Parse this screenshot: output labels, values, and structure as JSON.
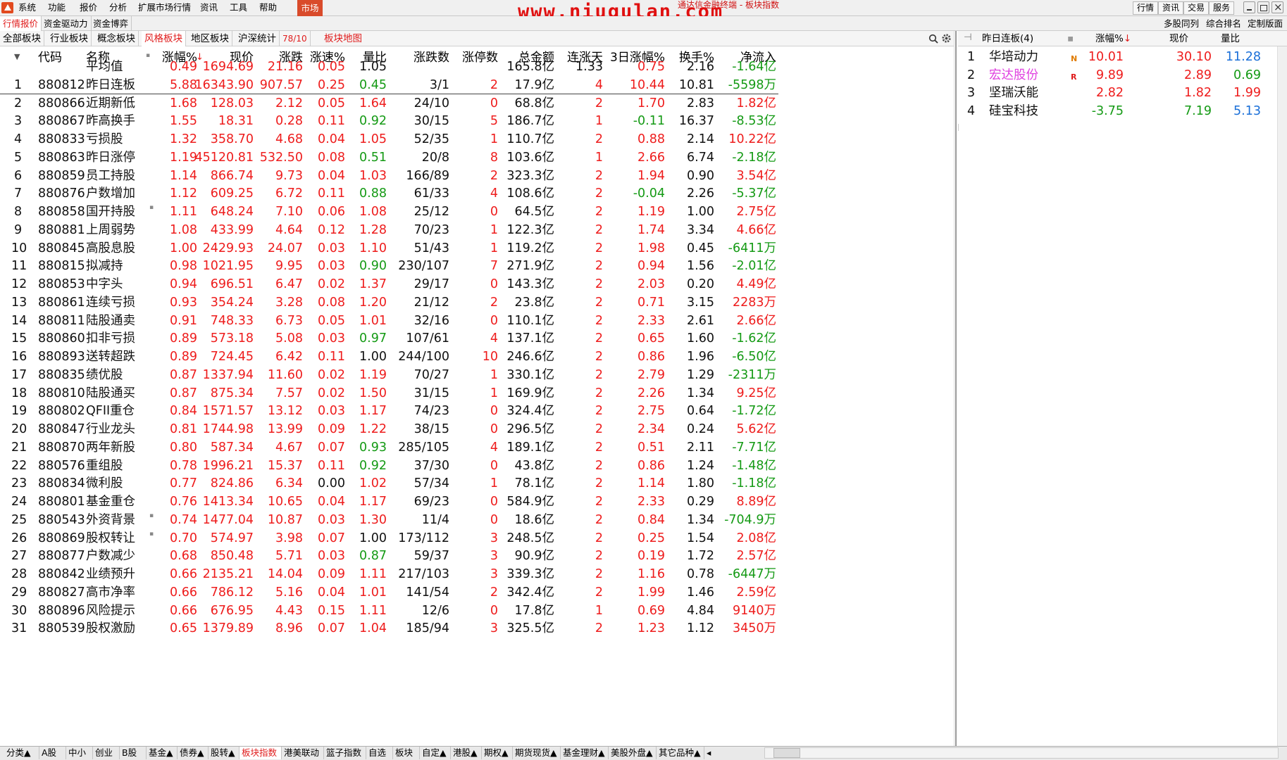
{
  "menubar": {
    "items": [
      "系统",
      "功能",
      "报价",
      "分析",
      "扩展市场行情",
      "资讯",
      "工具",
      "帮助"
    ],
    "market": "市场",
    "marquee": "通达信金融终端 - 板块指数",
    "watermark": "www.niugulan.com",
    "right_buttons": [
      "行情",
      "资讯",
      "交易",
      "服务"
    ]
  },
  "tabs_row2": {
    "items": [
      "行情报价",
      "资金驱动力",
      "资金博弈"
    ],
    "right": [
      "多股同列",
      "综合排名",
      "定制版面"
    ]
  },
  "tabs_row3": {
    "items": [
      "全部板块",
      "行业板块",
      "概念板块",
      "风格板块",
      "地区板块",
      "沪深统计"
    ],
    "count": "78/10",
    "extra": "板块地图"
  },
  "table": {
    "headers": [
      "代码",
      "名称",
      "涨幅%",
      "现价",
      "涨跌",
      "涨速%",
      "量比",
      "涨跌数",
      "涨停数",
      "总金额",
      "连涨天",
      "3日涨幅%",
      "换手%",
      "净流入"
    ],
    "average": {
      "label": "平均值",
      "vals": [
        "0.49",
        "1694.69",
        "21.16",
        "0.05",
        "1.05",
        "",
        "",
        "165.8亿",
        "1.33",
        "0.75",
        "2.16",
        "-1.64亿"
      ]
    },
    "rows": [
      [
        "1",
        "880812",
        "昨日连板",
        "5.88",
        "16343.90",
        "907.57",
        "0.25",
        "0.45",
        "3/1",
        "2",
        "17.9亿",
        "4",
        "10.44",
        "10.81",
        "-5598万"
      ],
      [
        "2",
        "880866",
        "近期新低",
        "1.68",
        "128.03",
        "2.12",
        "0.05",
        "1.64",
        "24/10",
        "0",
        "68.8亿",
        "2",
        "1.70",
        "2.83",
        "1.82亿"
      ],
      [
        "3",
        "880867",
        "昨高换手",
        "1.55",
        "18.31",
        "0.28",
        "0.11",
        "0.92",
        "30/15",
        "5",
        "186.7亿",
        "1",
        "-0.11",
        "16.37",
        "-8.53亿"
      ],
      [
        "4",
        "880833",
        "亏损股",
        "1.32",
        "358.70",
        "4.68",
        "0.04",
        "1.05",
        "52/35",
        "1",
        "110.7亿",
        "2",
        "0.88",
        "2.14",
        "10.22亿"
      ],
      [
        "5",
        "880863",
        "昨日涨停",
        "1.19",
        "45120.81",
        "532.50",
        "0.08",
        "0.51",
        "20/8",
        "8",
        "103.6亿",
        "1",
        "2.66",
        "6.74",
        "-2.18亿"
      ],
      [
        "6",
        "880859",
        "员工持股",
        "1.14",
        "866.74",
        "9.73",
        "0.04",
        "1.03",
        "166/89",
        "2",
        "323.3亿",
        "2",
        "1.94",
        "0.90",
        "3.54亿"
      ],
      [
        "7",
        "880876",
        "户数增加",
        "1.12",
        "609.25",
        "6.72",
        "0.11",
        "0.88",
        "61/33",
        "4",
        "108.6亿",
        "2",
        "-0.04",
        "2.26",
        "-5.37亿"
      ],
      [
        "8",
        "880858",
        "国开持股",
        "1.11",
        "648.24",
        "7.10",
        "0.06",
        "1.08",
        "25/12",
        "0",
        "64.5亿",
        "2",
        "1.19",
        "1.00",
        "2.75亿"
      ],
      [
        "9",
        "880881",
        "上周弱势",
        "1.08",
        "433.99",
        "4.64",
        "0.12",
        "1.28",
        "70/23",
        "1",
        "122.3亿",
        "2",
        "1.74",
        "3.34",
        "4.66亿"
      ],
      [
        "10",
        "880845",
        "高股息股",
        "1.00",
        "2429.93",
        "24.07",
        "0.03",
        "1.10",
        "51/43",
        "1",
        "119.2亿",
        "2",
        "1.98",
        "0.45",
        "-6411万"
      ],
      [
        "11",
        "880815",
        "拟减持",
        "0.98",
        "1021.95",
        "9.95",
        "0.03",
        "0.90",
        "230/107",
        "7",
        "271.9亿",
        "2",
        "0.94",
        "1.56",
        "-2.01亿"
      ],
      [
        "12",
        "880853",
        "中字头",
        "0.94",
        "696.51",
        "6.47",
        "0.02",
        "1.37",
        "29/17",
        "0",
        "143.3亿",
        "2",
        "2.03",
        "0.20",
        "4.49亿"
      ],
      [
        "13",
        "880861",
        "连续亏损",
        "0.93",
        "354.24",
        "3.28",
        "0.08",
        "1.20",
        "21/12",
        "2",
        "23.8亿",
        "2",
        "0.71",
        "3.15",
        "2283万"
      ],
      [
        "14",
        "880811",
        "陆股通卖",
        "0.91",
        "748.33",
        "6.73",
        "0.05",
        "1.01",
        "32/16",
        "0",
        "110.1亿",
        "2",
        "2.33",
        "2.61",
        "2.66亿"
      ],
      [
        "15",
        "880860",
        "扣非亏损",
        "0.89",
        "573.18",
        "5.08",
        "0.03",
        "0.97",
        "107/61",
        "4",
        "137.1亿",
        "2",
        "0.65",
        "1.60",
        "-1.62亿"
      ],
      [
        "16",
        "880893",
        "送转超跌",
        "0.89",
        "724.45",
        "6.42",
        "0.11",
        "1.00",
        "244/100",
        "10",
        "246.6亿",
        "2",
        "0.86",
        "1.96",
        "-6.50亿"
      ],
      [
        "17",
        "880835",
        "绩优股",
        "0.87",
        "1337.94",
        "11.60",
        "0.02",
        "1.19",
        "70/27",
        "1",
        "330.1亿",
        "2",
        "2.79",
        "1.29",
        "-2311万"
      ],
      [
        "18",
        "880810",
        "陆股通买",
        "0.87",
        "875.34",
        "7.57",
        "0.02",
        "1.50",
        "31/15",
        "1",
        "169.9亿",
        "2",
        "2.26",
        "1.34",
        "9.25亿"
      ],
      [
        "19",
        "880802",
        "QFII重仓",
        "0.84",
        "1571.57",
        "13.12",
        "0.03",
        "1.17",
        "74/23",
        "0",
        "324.4亿",
        "2",
        "2.75",
        "0.64",
        "-1.72亿"
      ],
      [
        "20",
        "880847",
        "行业龙头",
        "0.81",
        "1744.98",
        "13.99",
        "0.09",
        "1.22",
        "38/15",
        "0",
        "296.5亿",
        "2",
        "2.34",
        "0.24",
        "5.62亿"
      ],
      [
        "21",
        "880870",
        "两年新股",
        "0.80",
        "587.34",
        "4.67",
        "0.07",
        "0.93",
        "285/105",
        "4",
        "189.1亿",
        "2",
        "0.51",
        "2.11",
        "-7.71亿"
      ],
      [
        "22",
        "880576",
        "重组股",
        "0.78",
        "1996.21",
        "15.37",
        "0.11",
        "0.92",
        "37/30",
        "0",
        "43.8亿",
        "2",
        "0.86",
        "1.24",
        "-1.48亿"
      ],
      [
        "23",
        "880834",
        "微利股",
        "0.77",
        "824.86",
        "6.34",
        "0.00",
        "1.02",
        "57/34",
        "1",
        "78.1亿",
        "2",
        "1.14",
        "1.80",
        "-1.18亿"
      ],
      [
        "24",
        "880801",
        "基金重仓",
        "0.76",
        "1413.34",
        "10.65",
        "0.04",
        "1.17",
        "69/23",
        "0",
        "584.9亿",
        "2",
        "2.33",
        "0.29",
        "8.89亿"
      ],
      [
        "25",
        "880543",
        "外资背景",
        "0.74",
        "1477.04",
        "10.87",
        "0.03",
        "1.30",
        "11/4",
        "0",
        "18.6亿",
        "2",
        "0.84",
        "1.34",
        "-704.9万"
      ],
      [
        "26",
        "880869",
        "股权转让",
        "0.70",
        "574.97",
        "3.98",
        "0.07",
        "1.00",
        "173/112",
        "3",
        "248.5亿",
        "2",
        "0.25",
        "1.54",
        "2.08亿"
      ],
      [
        "27",
        "880877",
        "户数减少",
        "0.68",
        "850.48",
        "5.71",
        "0.03",
        "0.87",
        "59/37",
        "3",
        "90.9亿",
        "2",
        "0.19",
        "1.72",
        "2.57亿"
      ],
      [
        "28",
        "880842",
        "业绩预升",
        "0.66",
        "2135.21",
        "14.04",
        "0.09",
        "1.11",
        "217/103",
        "3",
        "339.3亿",
        "2",
        "1.16",
        "0.78",
        "-6447万"
      ],
      [
        "29",
        "880827",
        "高市净率",
        "0.66",
        "786.12",
        "5.16",
        "0.04",
        "1.01",
        "141/54",
        "2",
        "342.4亿",
        "2",
        "1.99",
        "1.46",
        "2.59亿"
      ],
      [
        "30",
        "880896",
        "风险提示",
        "0.66",
        "676.95",
        "4.43",
        "0.15",
        "1.11",
        "12/6",
        "0",
        "17.8亿",
        "1",
        "0.69",
        "4.84",
        "9140万"
      ],
      [
        "31",
        "880539",
        "股权激励",
        "0.65",
        "1379.89",
        "8.96",
        "0.07",
        "1.04",
        "185/94",
        "3",
        "325.5亿",
        "2",
        "1.23",
        "1.12",
        "3450万"
      ]
    ]
  },
  "right_panel": {
    "title": "昨日连板(4)",
    "headers": [
      "涨幅%",
      "现价",
      "量比"
    ],
    "rows": [
      [
        "1",
        "华培动力",
        "N",
        "10.01",
        "30.10",
        "11.28"
      ],
      [
        "2",
        "宏达股份",
        "R",
        "9.89",
        "2.89",
        "0.69"
      ],
      [
        "3",
        "坚瑞沃能",
        "",
        "2.82",
        "1.82",
        "1.99"
      ],
      [
        "4",
        "硅宝科技",
        "",
        "-3.75",
        "7.19",
        "5.13"
      ]
    ]
  },
  "bottom_tabs": [
    "分类▲",
    "A股",
    "中小",
    "创业",
    "B股",
    "基金▲",
    "债券▲",
    "股转▲",
    "板块指数",
    "港美联动",
    "篮子指数",
    "自选",
    "板块",
    "自定▲",
    "港股▲",
    "期权▲",
    "期货现货▲",
    "基金理财▲",
    "美股外盘▲",
    "其它品种▲"
  ],
  "colors": {
    "up": "#ee1c1c",
    "down": "#149a14",
    "neutral": "#111",
    "volratio_high": "#1a6fd8",
    "accent": "#d94b2b"
  }
}
